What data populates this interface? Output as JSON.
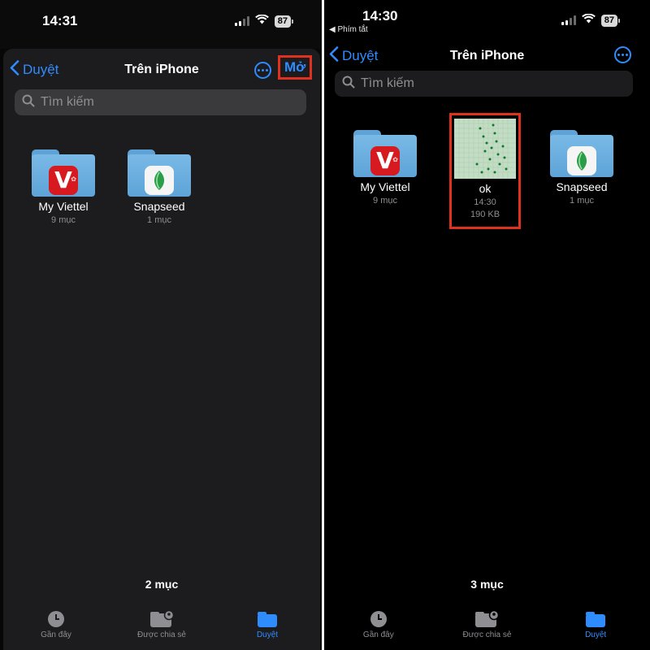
{
  "left": {
    "status": {
      "time": "14:31",
      "battery": "87"
    },
    "nav": {
      "back_label": "Duyệt",
      "title": "Trên iPhone",
      "open_label": "Mở"
    },
    "search": {
      "placeholder": "Tìm kiếm"
    },
    "items": [
      {
        "name": "My Viettel",
        "meta": "9 mục",
        "icon": "viettel-app-icon"
      },
      {
        "name": "Snapseed",
        "meta": "1 mục",
        "icon": "snapseed-app-icon"
      }
    ],
    "count": "2 mục",
    "tabs": [
      {
        "label": "Gần đây",
        "icon": "clock-icon"
      },
      {
        "label": "Được chia sẻ",
        "icon": "shared-folder-icon"
      },
      {
        "label": "Duyệt",
        "icon": "folder-icon",
        "active": true
      }
    ]
  },
  "right": {
    "status": {
      "time": "14:30",
      "back_app": "◀ Phím tắt",
      "battery": "87"
    },
    "nav": {
      "back_label": "Duyệt",
      "title": "Trên iPhone"
    },
    "search": {
      "placeholder": "Tìm kiếm"
    },
    "items": [
      {
        "name": "My Viettel",
        "meta": "9 mục",
        "icon": "viettel-app-icon"
      },
      {
        "name": "ok",
        "meta": "14:30",
        "size": "190 KB",
        "icon": "image-thumbnail"
      },
      {
        "name": "Snapseed",
        "meta": "1 mục",
        "icon": "snapseed-app-icon"
      }
    ],
    "count": "3 mục",
    "tabs": [
      {
        "label": "Gần đây",
        "icon": "clock-icon"
      },
      {
        "label": "Được chia sẻ",
        "icon": "shared-folder-icon"
      },
      {
        "label": "Duyệt",
        "icon": "folder-icon",
        "active": true
      }
    ]
  },
  "colors": {
    "accent": "#2f8cff",
    "highlight": "#e0301e",
    "folder": "#6aaedf"
  }
}
